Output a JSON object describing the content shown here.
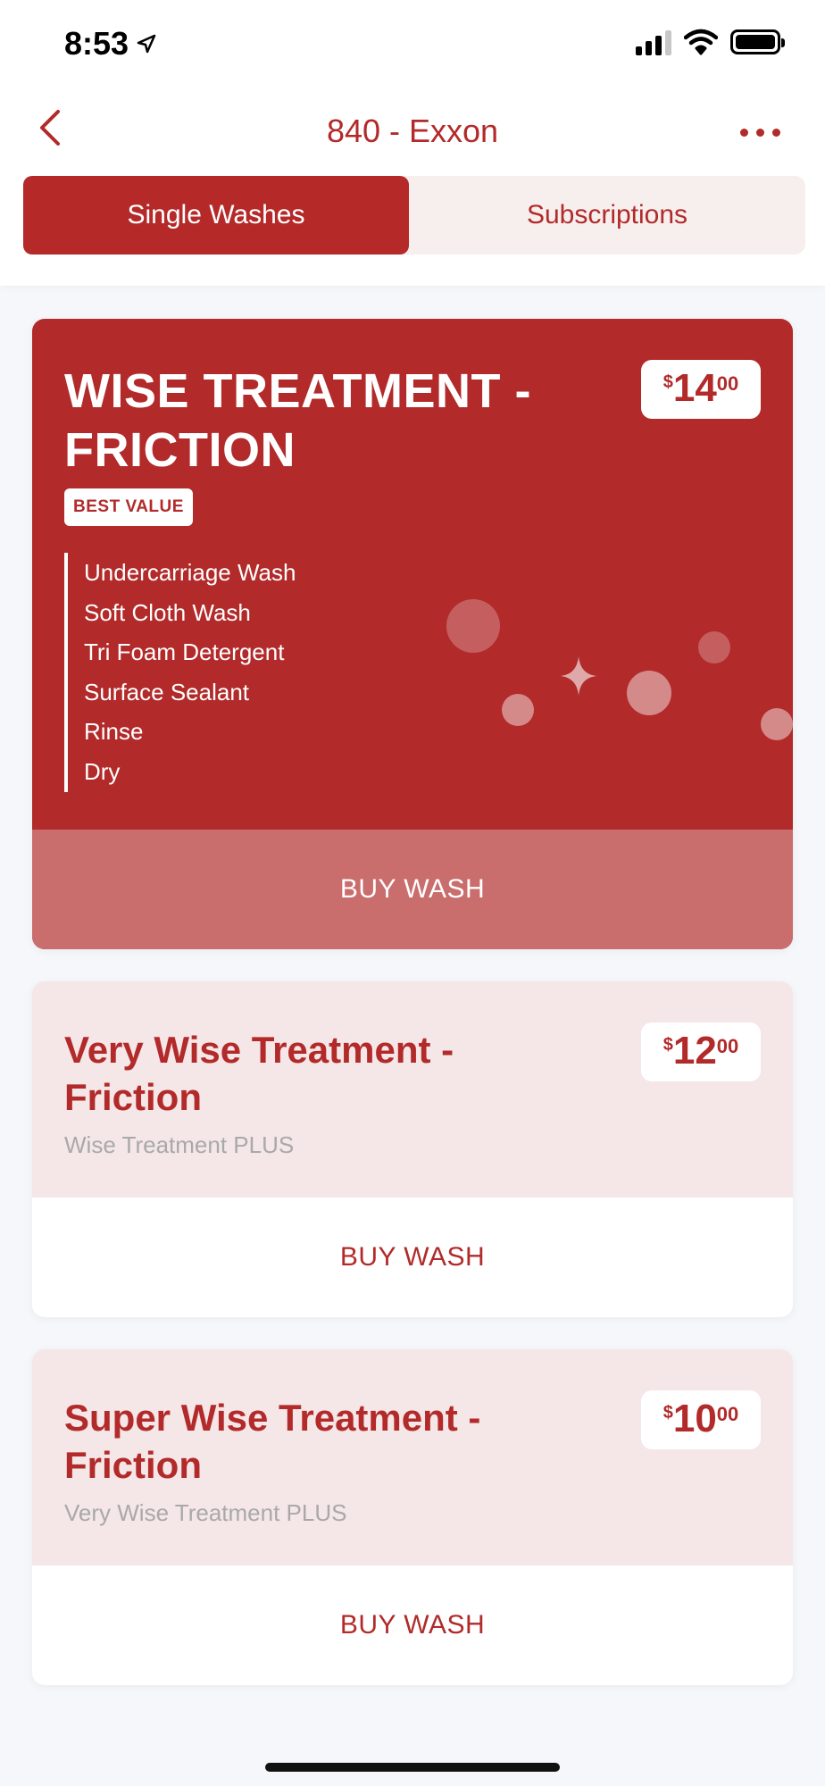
{
  "status_bar": {
    "time": "8:53"
  },
  "nav": {
    "title": "840 - Exxon"
  },
  "tabs": [
    {
      "label": "Single Washes",
      "active": true
    },
    {
      "label": "Subscriptions",
      "active": false
    }
  ],
  "featured": {
    "title": "WISE TREATMENT - FRICTION",
    "badge": "BEST VALUE",
    "price": {
      "currency": "$",
      "dollars": "14",
      "cents": "00"
    },
    "features": [
      "Undercarriage Wash",
      "Soft Cloth Wash",
      "Tri Foam Detergent",
      "Surface Sealant",
      "Rinse",
      "Dry"
    ],
    "buy_label": "BUY WASH"
  },
  "packages": [
    {
      "title": "Very Wise Treatment - Friction",
      "subtitle": "Wise Treatment PLUS",
      "price": {
        "currency": "$",
        "dollars": "12",
        "cents": "00"
      },
      "buy_label": "BUY WASH"
    },
    {
      "title": "Super Wise Treatment - Friction",
      "subtitle": "Very Wise Treatment PLUS",
      "price": {
        "currency": "$",
        "dollars": "10",
        "cents": "00"
      },
      "buy_label": "BUY WASH"
    }
  ],
  "colors": {
    "brand": "#b22a2a",
    "buy_featured_bg": "#ca6d6d",
    "card_top_bg": "#f5e6e7"
  }
}
